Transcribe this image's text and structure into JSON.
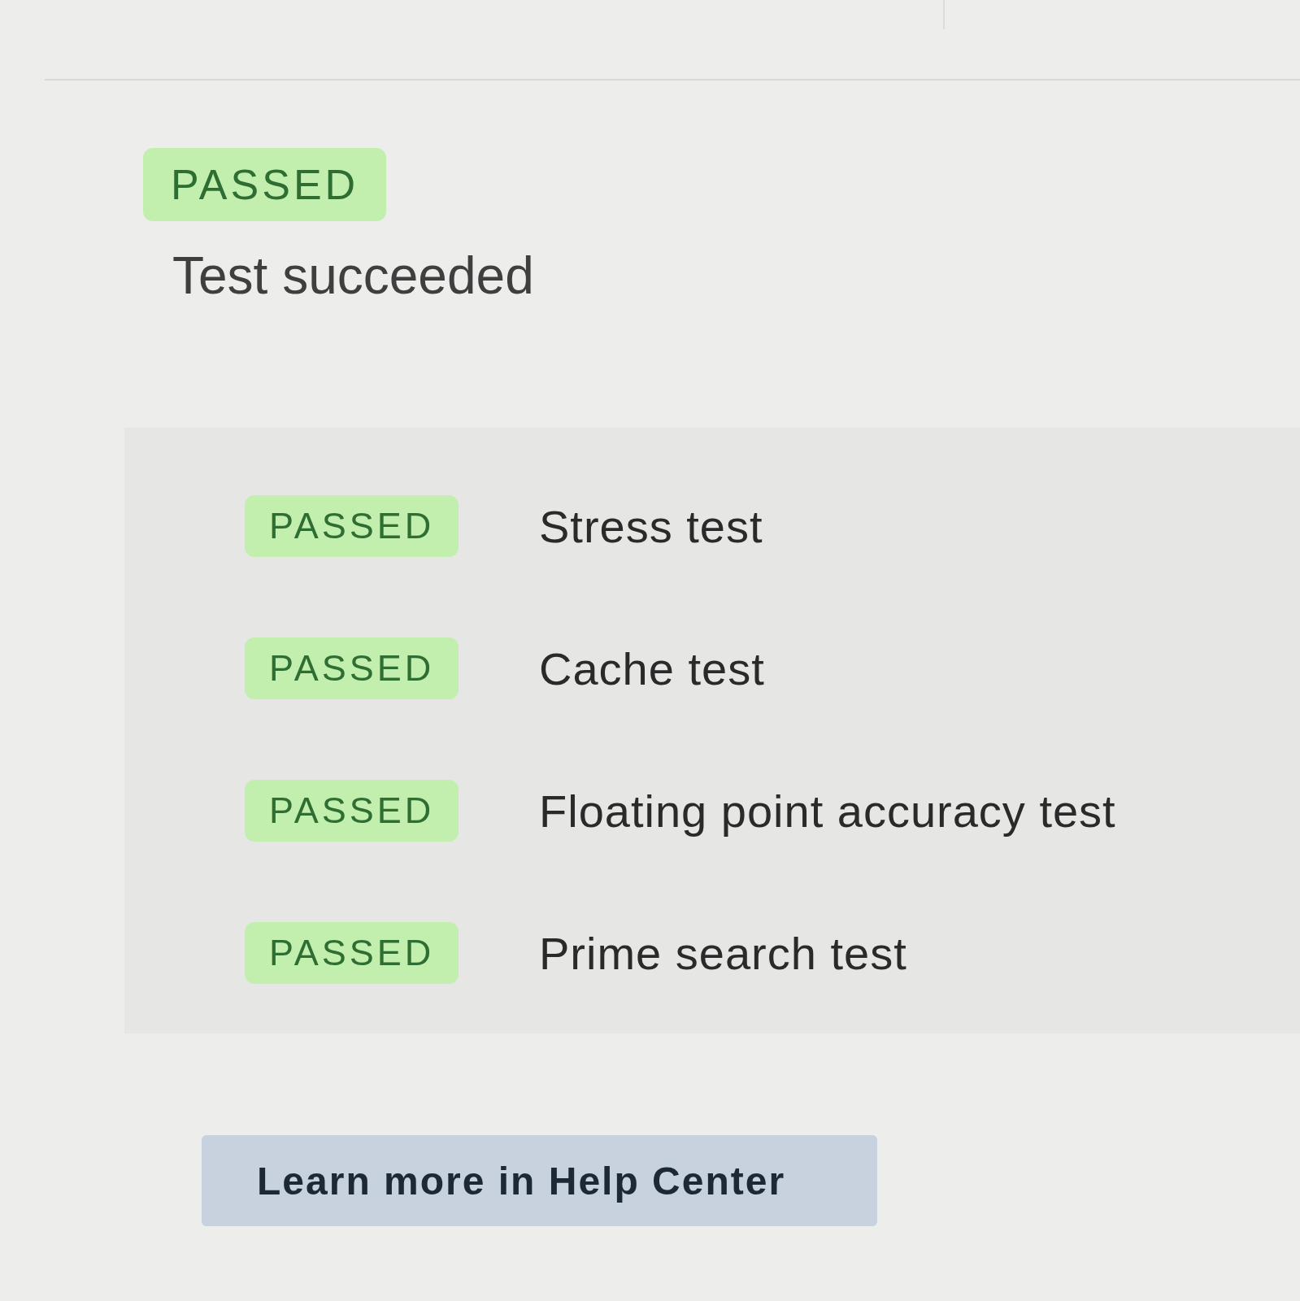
{
  "summary": {
    "badge": {
      "label": "PASSED",
      "kind": "passed"
    },
    "message": "Test succeeded"
  },
  "tests": [
    {
      "badge": {
        "label": "PASSED",
        "kind": "passed"
      },
      "name": "Stress test"
    },
    {
      "badge": {
        "label": "PASSED",
        "kind": "passed"
      },
      "name": "Cache test"
    },
    {
      "badge": {
        "label": "PASSED",
        "kind": "passed"
      },
      "name": "Floating point accuracy test"
    },
    {
      "badge": {
        "label": "PASSED",
        "kind": "passed"
      },
      "name": "Prime search test"
    }
  ],
  "help_button": {
    "label": "Learn more in Help Center"
  }
}
